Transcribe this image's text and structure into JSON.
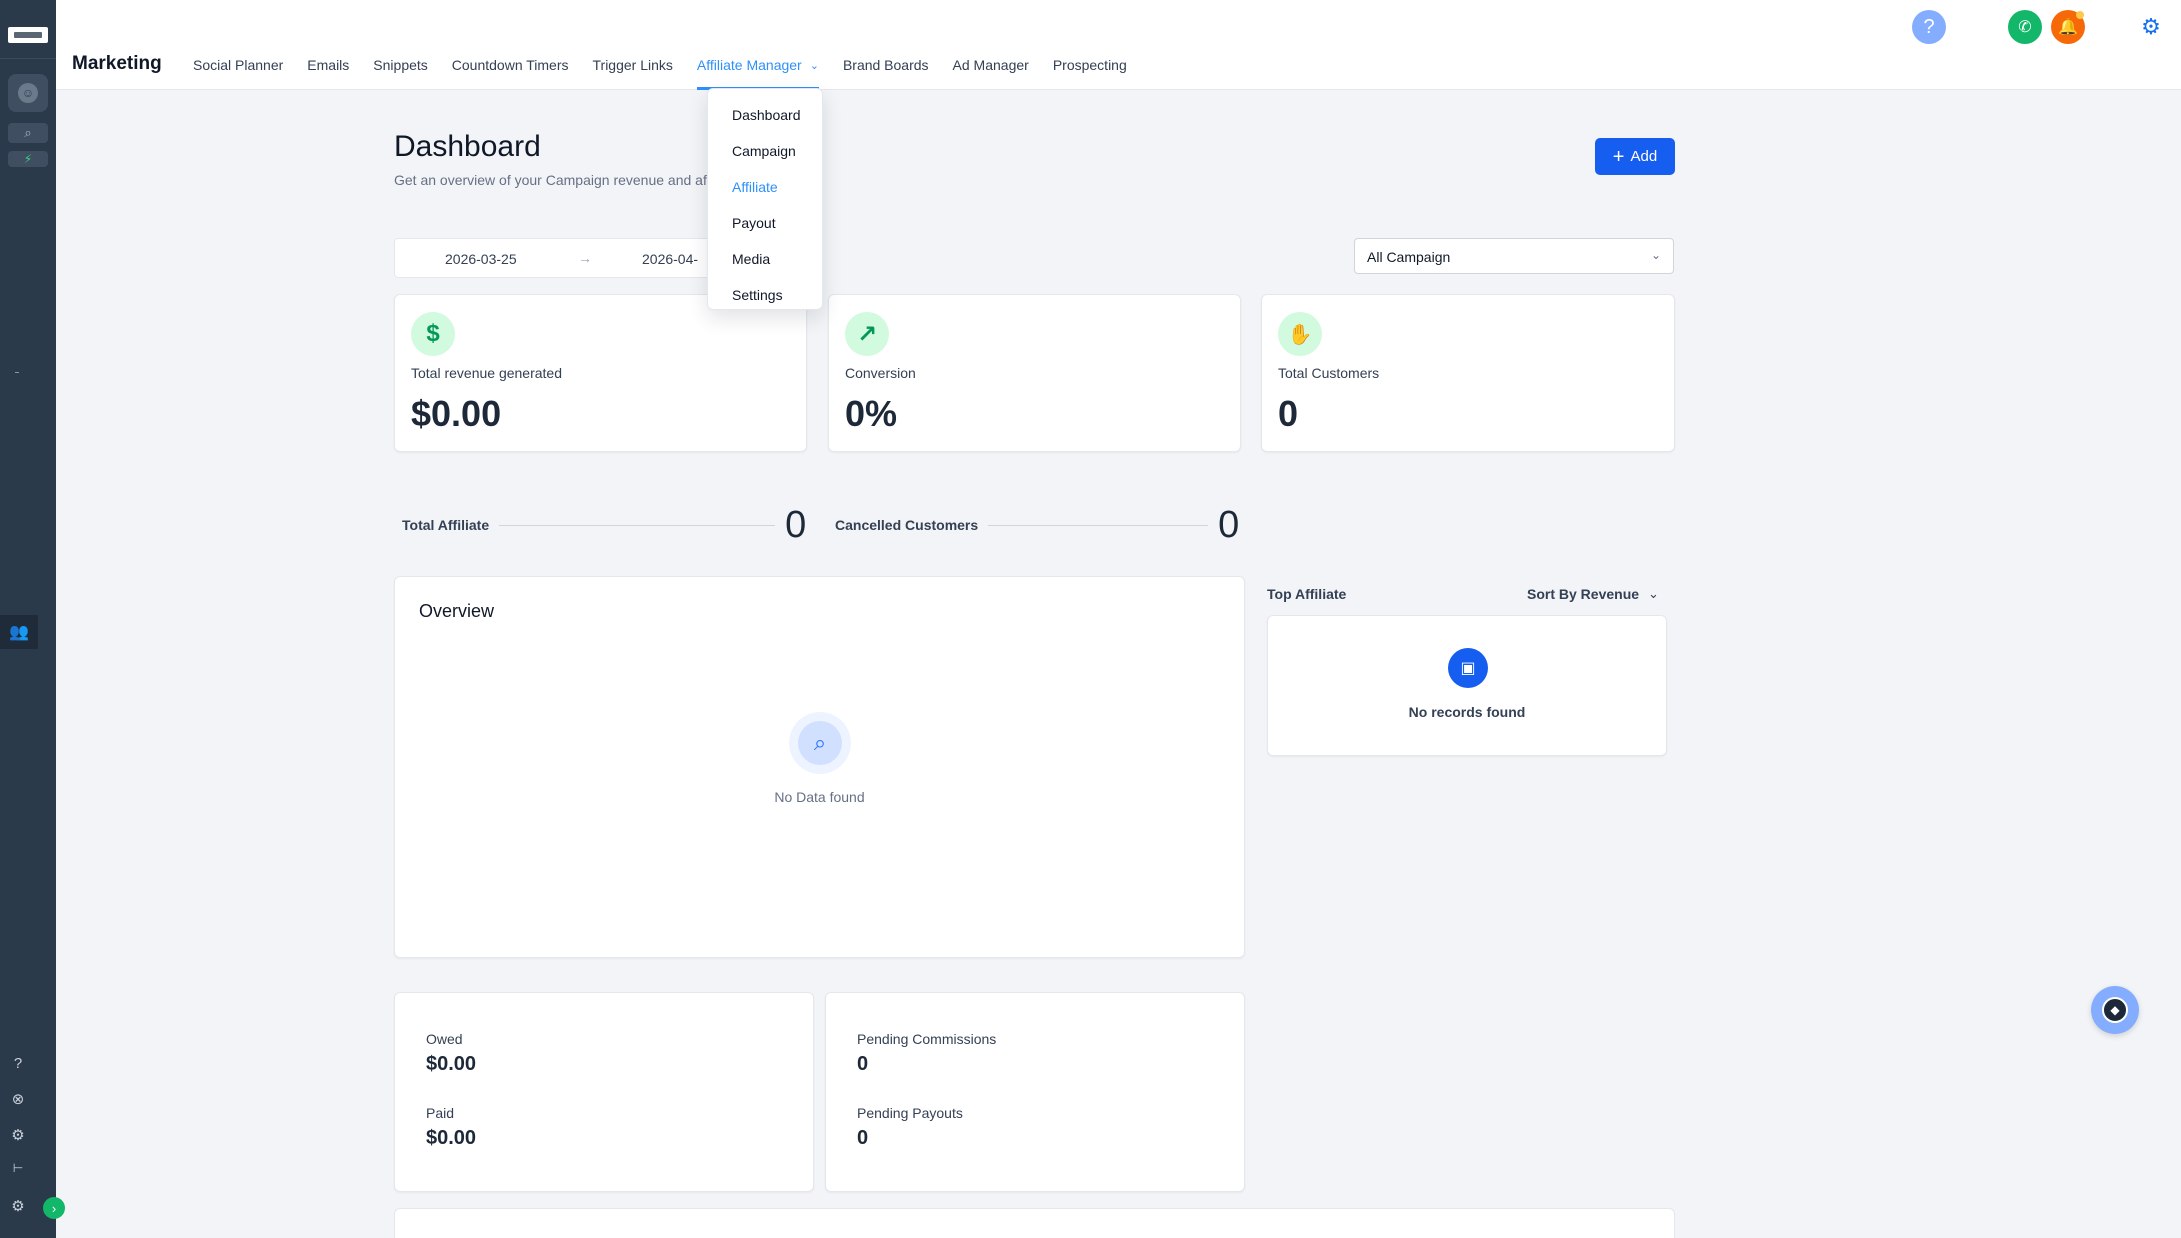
{
  "app": {
    "title": "Marketing"
  },
  "nav": {
    "items": [
      {
        "label": "Social Planner"
      },
      {
        "label": "Emails"
      },
      {
        "label": "Snippets"
      },
      {
        "label": "Countdown Timers"
      },
      {
        "label": "Trigger Links"
      },
      {
        "label": "Affiliate Manager",
        "active": true
      },
      {
        "label": "Brand Boards"
      },
      {
        "label": "Ad Manager"
      },
      {
        "label": "Prospecting"
      }
    ]
  },
  "dropdown": {
    "items": [
      {
        "label": "Dashboard"
      },
      {
        "label": "Campaign"
      },
      {
        "label": "Affiliate",
        "selected": true
      },
      {
        "label": "Payout"
      },
      {
        "label": "Media"
      },
      {
        "label": "Settings"
      }
    ]
  },
  "page": {
    "title": "Dashboard",
    "subtitle": "Get an overview of your Campaign revenue and affiliate conversions",
    "add_label": "Add"
  },
  "filters": {
    "date_start": "2026-03-25",
    "date_end": "2026-04-",
    "campaign": "All Campaign"
  },
  "stats": [
    {
      "label": "Total revenue generated",
      "value": "$0.00",
      "icon": "dollar-icon"
    },
    {
      "label": "Conversion",
      "value": "0%",
      "icon": "trend-up-icon"
    },
    {
      "label": "Total Customers",
      "value": "0",
      "icon": "hand-coins-icon"
    }
  ],
  "inline_stats": {
    "total_affiliate": {
      "label": "Total Affiliate",
      "value": "0"
    },
    "cancelled_customers": {
      "label": "Cancelled Customers",
      "value": "0"
    }
  },
  "overview": {
    "title": "Overview",
    "empty_text": "No Data found"
  },
  "top_affiliate": {
    "label": "Top Affiliate",
    "sort_label": "Sort By Revenue",
    "empty_text": "No records found"
  },
  "finance": {
    "owed": {
      "label": "Owed",
      "value": "$0.00"
    },
    "paid": {
      "label": "Paid",
      "value": "$0.00"
    },
    "pending_commissions": {
      "label": "Pending Commissions",
      "value": "0"
    },
    "pending_payouts": {
      "label": "Pending Payouts",
      "value": "0"
    }
  },
  "colors": {
    "primary": "#155eef",
    "accent": "#2e90fa",
    "sidebar": "#2b3a4a",
    "success": "#12b76a",
    "warning": "#f76808"
  }
}
